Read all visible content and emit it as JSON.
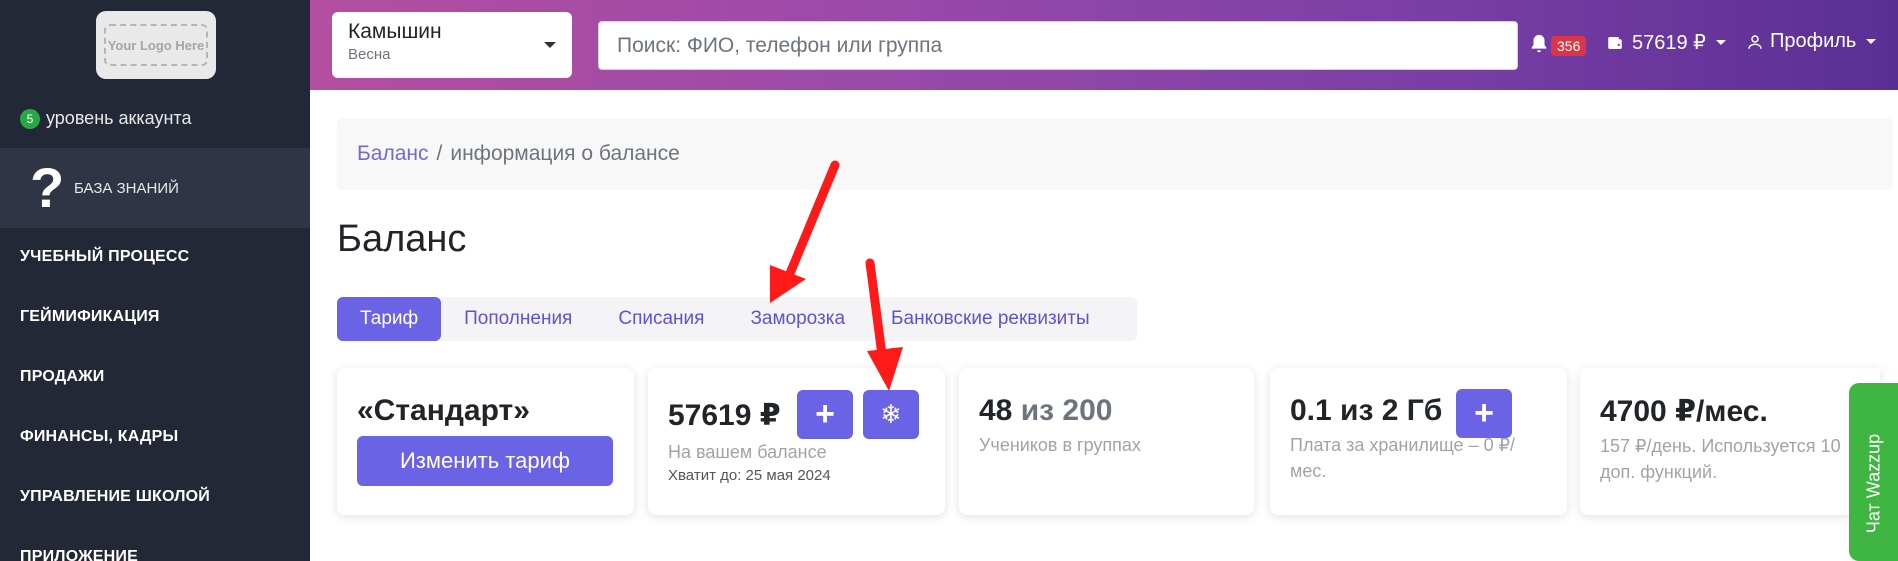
{
  "sidebar": {
    "logo_text": "Your Logo Here",
    "account_level": {
      "badge": "5",
      "label": "уровень аккаунта"
    },
    "knowledge_base": {
      "icon": "?",
      "label": "БАЗА ЗНАНИЙ"
    },
    "items": [
      {
        "label": "УЧЕБНЫЙ ПРОЦЕСС"
      },
      {
        "label": "ГЕЙМИФИКАЦИЯ"
      },
      {
        "label": "ПРОДАЖИ"
      },
      {
        "label": "ФИНАНСЫ, КАДРЫ"
      },
      {
        "label": "УПРАВЛЕНИЕ ШКОЛОЙ"
      },
      {
        "label": "ПРИЛОЖЕНИЕ"
      }
    ]
  },
  "header": {
    "city": {
      "name": "Камышин",
      "season": "Весна"
    },
    "search_placeholder": "Поиск: ФИО, телефон или группа",
    "notifications_count": "356",
    "balance": "57619 ₽",
    "profile_label": "Профиль"
  },
  "breadcrumb": {
    "link": "Баланс",
    "separator": "/",
    "current": "информация о балансе"
  },
  "page_title": "Баланс",
  "tabs": [
    {
      "label": "Тариф",
      "active": true
    },
    {
      "label": "Пополнения"
    },
    {
      "label": "Списания"
    },
    {
      "label": "Заморозка"
    },
    {
      "label": "Банковские реквизиты"
    }
  ],
  "cards": {
    "tariff": {
      "title": "«Стандарт»",
      "button": "Изменить тариф"
    },
    "balance": {
      "amount": "57619 ₽",
      "plus": "+",
      "freeze": "❄",
      "subtitle": "На вашем балансе",
      "until": "Хватит до: 25 мая 2024"
    },
    "students": {
      "count": "48",
      "of": "из 200",
      "subtitle": "Учеников в группах"
    },
    "storage": {
      "value": "0.1 из 2 Гб",
      "plus": "+",
      "subtitle": "Плата за хранилище – 0 ₽/мес."
    },
    "price": {
      "value": "4700 ₽/мес.",
      "subtitle": "157 ₽/день. Используется 10 доп. функций."
    }
  },
  "wazzup_label": "Чат Wazzup",
  "colors": {
    "accent": "#6b63e6",
    "sidebar": "#232836",
    "annotation_arrow": "#ff1a1a",
    "wazzup": "#3fb542"
  }
}
